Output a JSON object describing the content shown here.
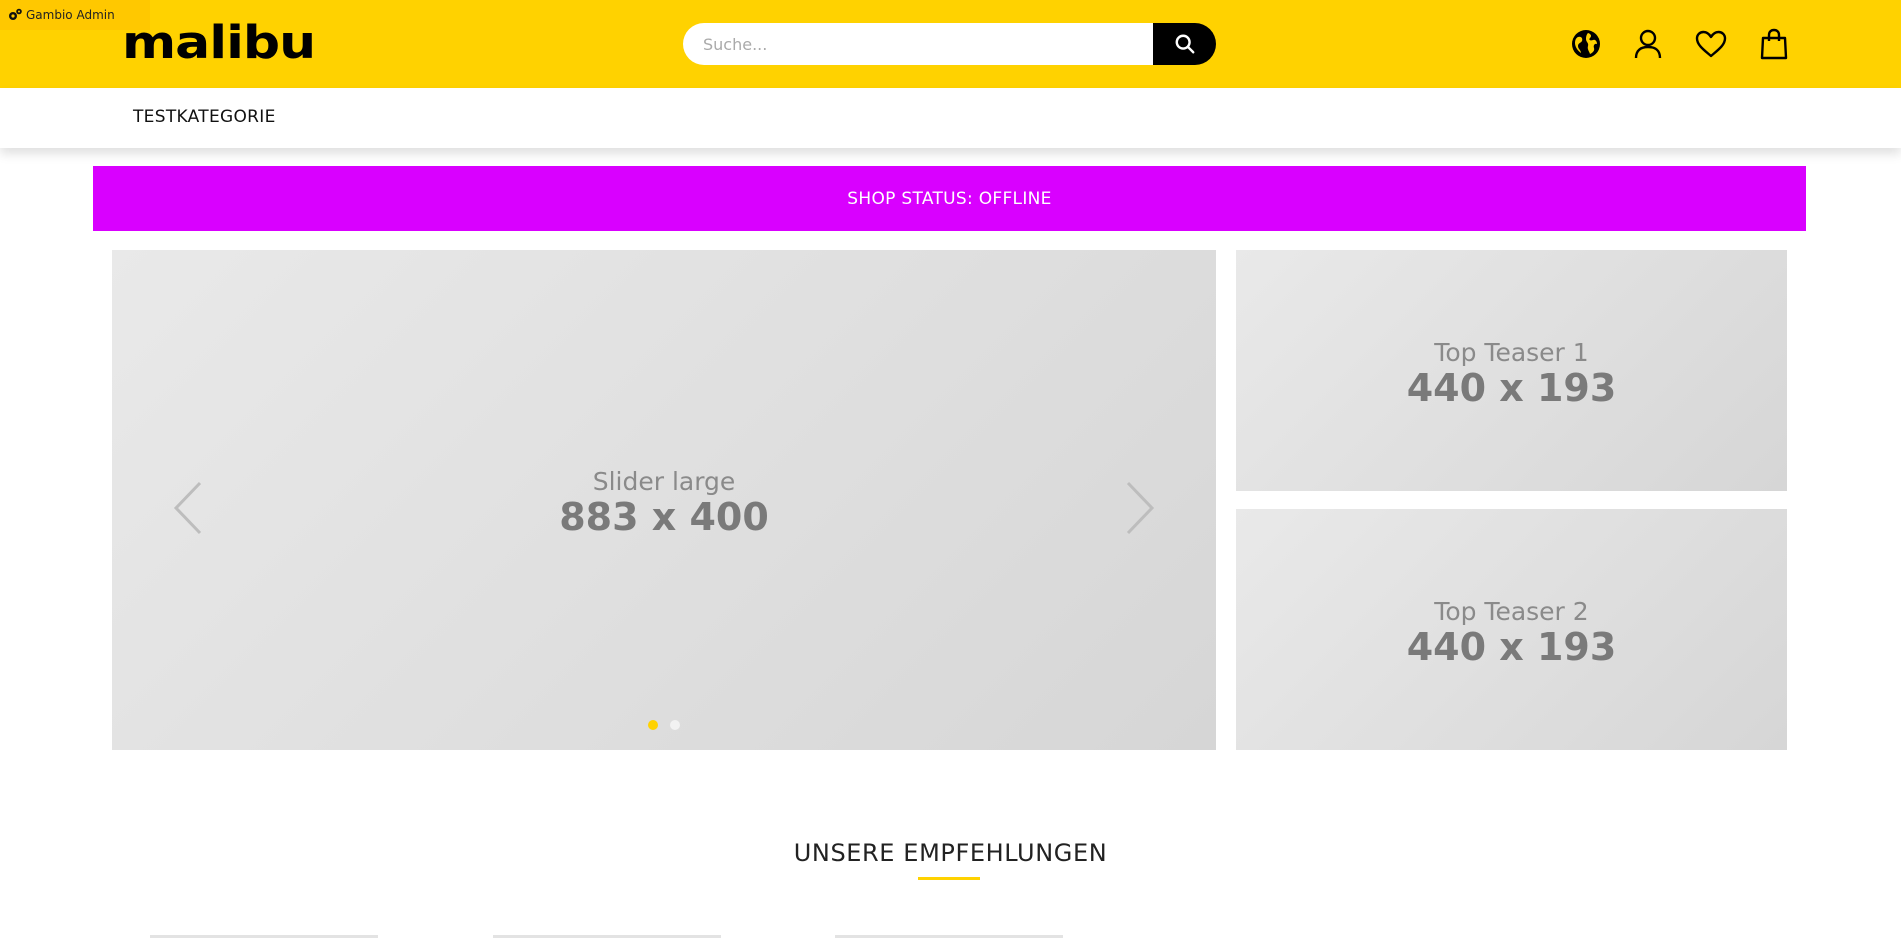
{
  "admin": {
    "label": "Gambio Admin"
  },
  "header": {
    "logo": "malibu",
    "search_placeholder": "Suche...",
    "icons": [
      "globe-icon",
      "user-icon",
      "heart-icon",
      "shopping-bag-icon"
    ]
  },
  "nav": {
    "items": [
      {
        "label": "TESTKATEGORIE"
      }
    ]
  },
  "status": {
    "text": "SHOP STATUS: OFFLINE"
  },
  "slider": {
    "title": "Slider large",
    "size": "883 x 400",
    "dots": 2,
    "active_dot": 1
  },
  "teasers": [
    {
      "title": "Top Teaser 1",
      "size": "440 x 193"
    },
    {
      "title": "Top Teaser 2",
      "size": "440 x 193"
    }
  ],
  "recommendations": {
    "title": "UNSERE EMPFEHLUNGEN"
  },
  "colors": {
    "brand_yellow": "#ffd200",
    "status_bg": "#d900ff",
    "text_dark": "#111111"
  }
}
